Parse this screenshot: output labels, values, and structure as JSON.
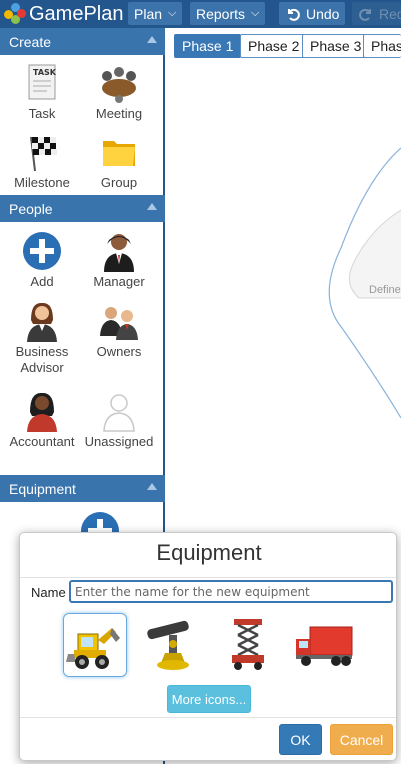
{
  "app": {
    "name": "GamePlan"
  },
  "toolbar": {
    "plan_label": "Plan",
    "reports_label": "Reports",
    "undo_label": "Undo",
    "redo_label": "Redo"
  },
  "sidebar": {
    "create": {
      "header": "Create",
      "items": [
        {
          "label": "Task",
          "icon": "task-note-icon"
        },
        {
          "label": "Meeting",
          "icon": "meeting-table-icon"
        },
        {
          "label": "Milestone",
          "icon": "checkered-flag-icon"
        },
        {
          "label": "Group",
          "icon": "folder-icon"
        }
      ]
    },
    "people": {
      "header": "People",
      "items": [
        {
          "label": "Add",
          "icon": "add-plus-icon"
        },
        {
          "label": "Manager",
          "icon": "manager-person-icon"
        },
        {
          "label": "Business Advisor",
          "icon": "business-advisor-person-icon"
        },
        {
          "label": "Owners",
          "icon": "owners-group-icon"
        },
        {
          "label": "Accountant",
          "icon": "accountant-person-icon"
        },
        {
          "label": "Unassigned",
          "icon": "unassigned-person-icon"
        }
      ]
    },
    "equipment": {
      "header": "Equipment",
      "items": [
        {
          "icon": "add-plus-icon"
        }
      ]
    }
  },
  "canvas": {
    "phases": [
      "Phase 1",
      "Phase 2",
      "Phase 3",
      "Phase"
    ],
    "active_phase": "Phase 1",
    "node_text": "Define"
  },
  "modal": {
    "title": "Equipment",
    "name_label": "Name",
    "name_value": "",
    "name_placeholder": "Enter the name for the new equipment",
    "icons": [
      "backhoe-loader-icon",
      "surveying-telescope-icon",
      "scissor-lift-icon",
      "delivery-truck-icon"
    ],
    "selected_icon": "backhoe-loader-icon",
    "more_icons_label": "More icons...",
    "ok_label": "OK",
    "cancel_label": "Cancel"
  },
  "colors": {
    "topbar": "#22568c",
    "section_header": "#3a74ad",
    "primary": "#337ab7",
    "info": "#5bc0de",
    "warning": "#f0ad4e"
  }
}
